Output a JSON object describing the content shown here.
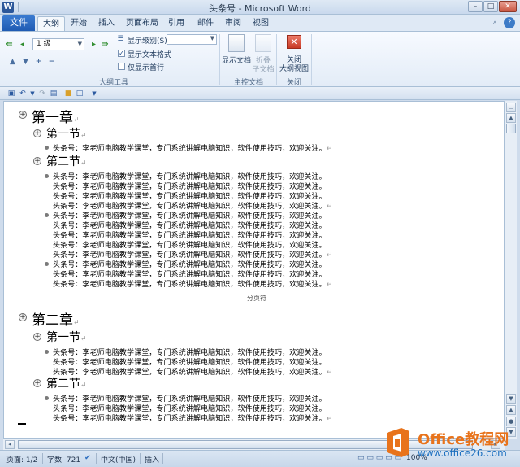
{
  "window": {
    "title": "头条号 - Microsoft Word",
    "app_letter": "W"
  },
  "window_controls": {
    "minimize": "–",
    "maximize": "□",
    "close": "✕"
  },
  "tabs": [
    {
      "label": "文件"
    },
    {
      "label": "大纲"
    },
    {
      "label": "开始"
    },
    {
      "label": "插入"
    },
    {
      "label": "页面布局"
    },
    {
      "label": "引用"
    },
    {
      "label": "邮件"
    },
    {
      "label": "审阅"
    },
    {
      "label": "视图"
    }
  ],
  "ribbon": {
    "outline_tools": {
      "group_label": "大纲工具",
      "level_value": "1 级",
      "show_level_label": "显示级别(S):",
      "show_text_format_label": "显示文本格式",
      "show_text_format_checked": true,
      "show_first_line_only_label": "仅显示首行",
      "show_first_line_only_checked": false
    },
    "master_document": {
      "group_label": "主控文档",
      "show_document_label": "显示文档",
      "collapse_subdocs_label_1": "折叠",
      "collapse_subdocs_label_2": "子文档"
    },
    "close": {
      "group_label": "关闭",
      "close_outline_label_1": "关闭",
      "close_outline_label_2": "大纲视图"
    }
  },
  "document": {
    "page_break_label": "分页符",
    "body_text": "头条号：李老师电脑教学课堂，专门系统讲解电脑知识，软件使用技巧，欢迎关注。",
    "para_mark": "↵",
    "chapters": [
      {
        "title": "第一章",
        "sections": [
          {
            "title": "第一节"
          },
          {
            "title": "第二节"
          }
        ]
      },
      {
        "title": "第二章",
        "sections": [
          {
            "title": "第一节"
          },
          {
            "title": "第二节"
          }
        ]
      }
    ]
  },
  "statusbar": {
    "page": "页面: 1/2",
    "words": "字数: 721",
    "language": "中文(中国)",
    "mode": "插入",
    "zoom": "100%"
  },
  "watermark": {
    "name": "Office教程网",
    "url": "www.office26.com"
  },
  "colors": {
    "file_tab": "#1f5bb3",
    "close_button": "#c83a25",
    "watermark_orange": "#e8731b",
    "watermark_blue": "#1b6fbf"
  }
}
